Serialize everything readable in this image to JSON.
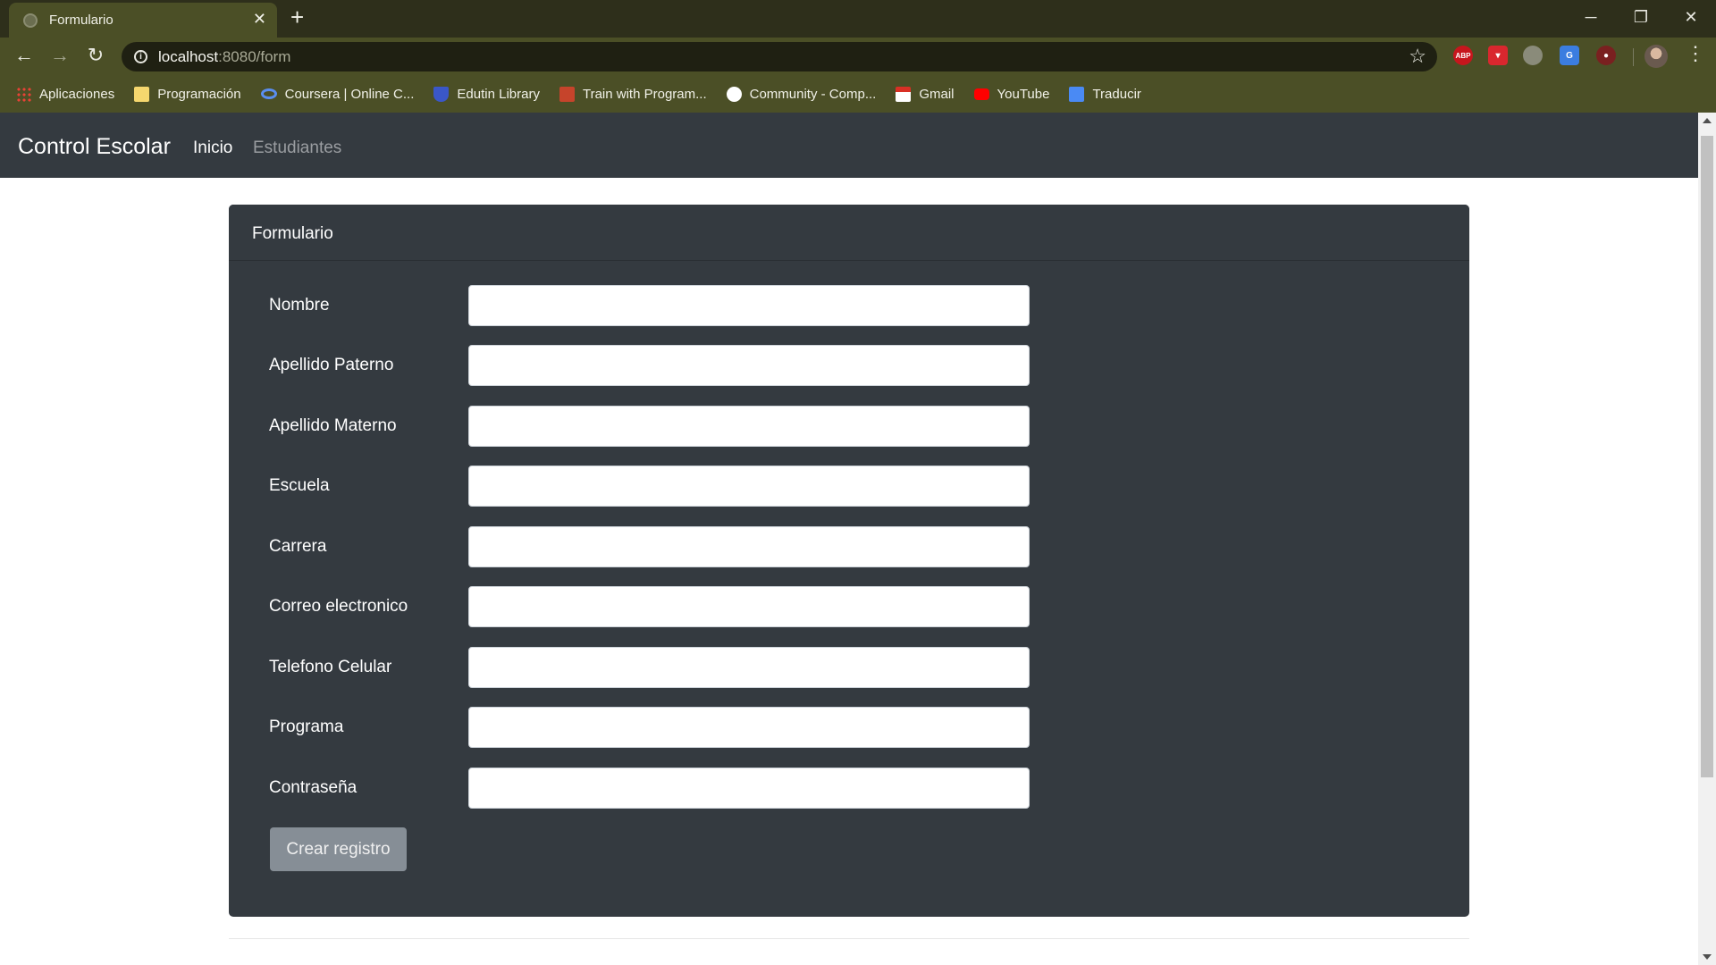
{
  "browser": {
    "tab_title": "Formulario",
    "tab_close": "✕",
    "new_tab": "+",
    "window_controls": {
      "minimize": "─",
      "restore": "❐",
      "close": "✕"
    },
    "url_host": "localhost",
    "url_rest": ":8080/form",
    "bookmarks": [
      {
        "label": "Aplicaciones",
        "icon": "apps-icon"
      },
      {
        "label": "Programación",
        "icon": "folder-icon"
      },
      {
        "label": "Coursera | Online C...",
        "icon": "coursera-icon"
      },
      {
        "label": "Edutin Library",
        "icon": "edutin-icon"
      },
      {
        "label": "Train with Program...",
        "icon": "train-icon"
      },
      {
        "label": "Community - Comp...",
        "icon": "community-icon"
      },
      {
        "label": "Gmail",
        "icon": "gmail-icon"
      },
      {
        "label": "YouTube",
        "icon": "youtube-icon"
      },
      {
        "label": "Traducir",
        "icon": "translate-icon"
      }
    ],
    "extensions": {
      "abp": "ABP"
    }
  },
  "navbar": {
    "brand": "Control Escolar",
    "links": [
      {
        "label": "Inicio",
        "active": true
      },
      {
        "label": "Estudiantes",
        "active": false
      }
    ]
  },
  "form": {
    "title": "Formulario",
    "fields": [
      {
        "label": "Nombre",
        "value": ""
      },
      {
        "label": "Apellido Paterno",
        "value": ""
      },
      {
        "label": "Apellido Materno",
        "value": ""
      },
      {
        "label": "Escuela",
        "value": ""
      },
      {
        "label": "Carrera",
        "value": ""
      },
      {
        "label": "Correo electronico",
        "value": ""
      },
      {
        "label": "Telefono Celular",
        "value": ""
      },
      {
        "label": "Programa",
        "value": ""
      },
      {
        "label": "Contraseña",
        "value": ""
      }
    ],
    "submit_label": "Crear registro"
  },
  "colors": {
    "navbar_bg": "#343a40",
    "card_bg": "#343a40",
    "button_bg": "#868e96",
    "chrome_frame": "#4b4f26"
  }
}
